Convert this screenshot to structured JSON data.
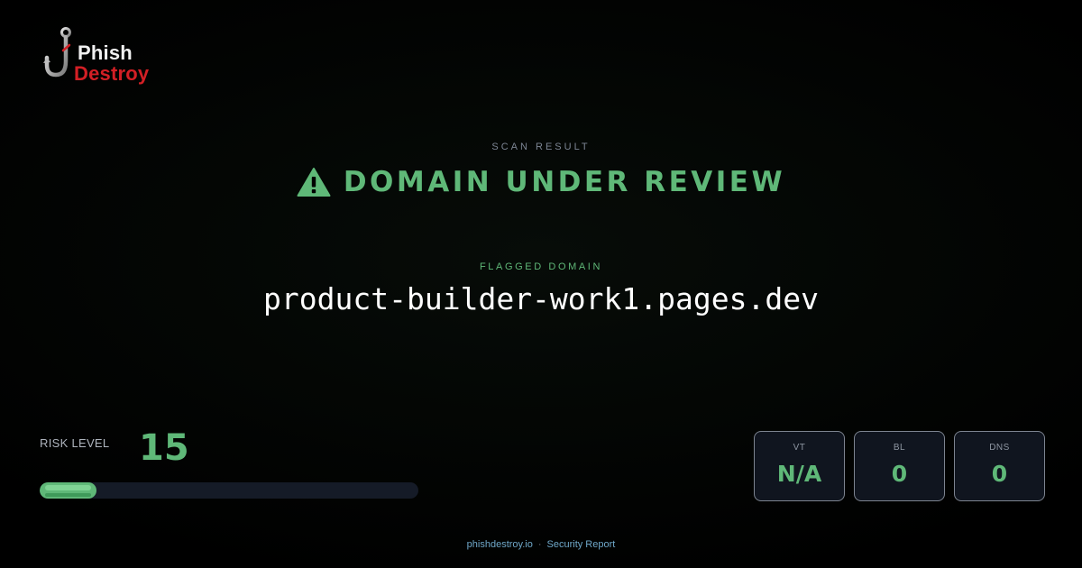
{
  "brand": {
    "name_line1": "Phish",
    "name_line2": "Destroy",
    "logo_icon": "fish-hook-icon",
    "colors": {
      "primary": "#f0f0f0",
      "accent": "#d21f25"
    }
  },
  "scan": {
    "label": "SCAN RESULT",
    "status": "DOMAIN UNDER REVIEW",
    "status_icon": "warning-triangle-icon",
    "status_color": "#5fb878"
  },
  "flagged": {
    "label": "FLAGGED DOMAIN",
    "domain": "product-builder-work1.pages.dev"
  },
  "risk": {
    "label": "RISK LEVEL",
    "value": "15",
    "percent": 15
  },
  "stats": [
    {
      "label": "VT",
      "value": "N/A"
    },
    {
      "label": "BL",
      "value": "0"
    },
    {
      "label": "DNS",
      "value": "0"
    }
  ],
  "footer": {
    "site": "phishdestroy.io",
    "separator": "·",
    "report": "Security Report"
  }
}
